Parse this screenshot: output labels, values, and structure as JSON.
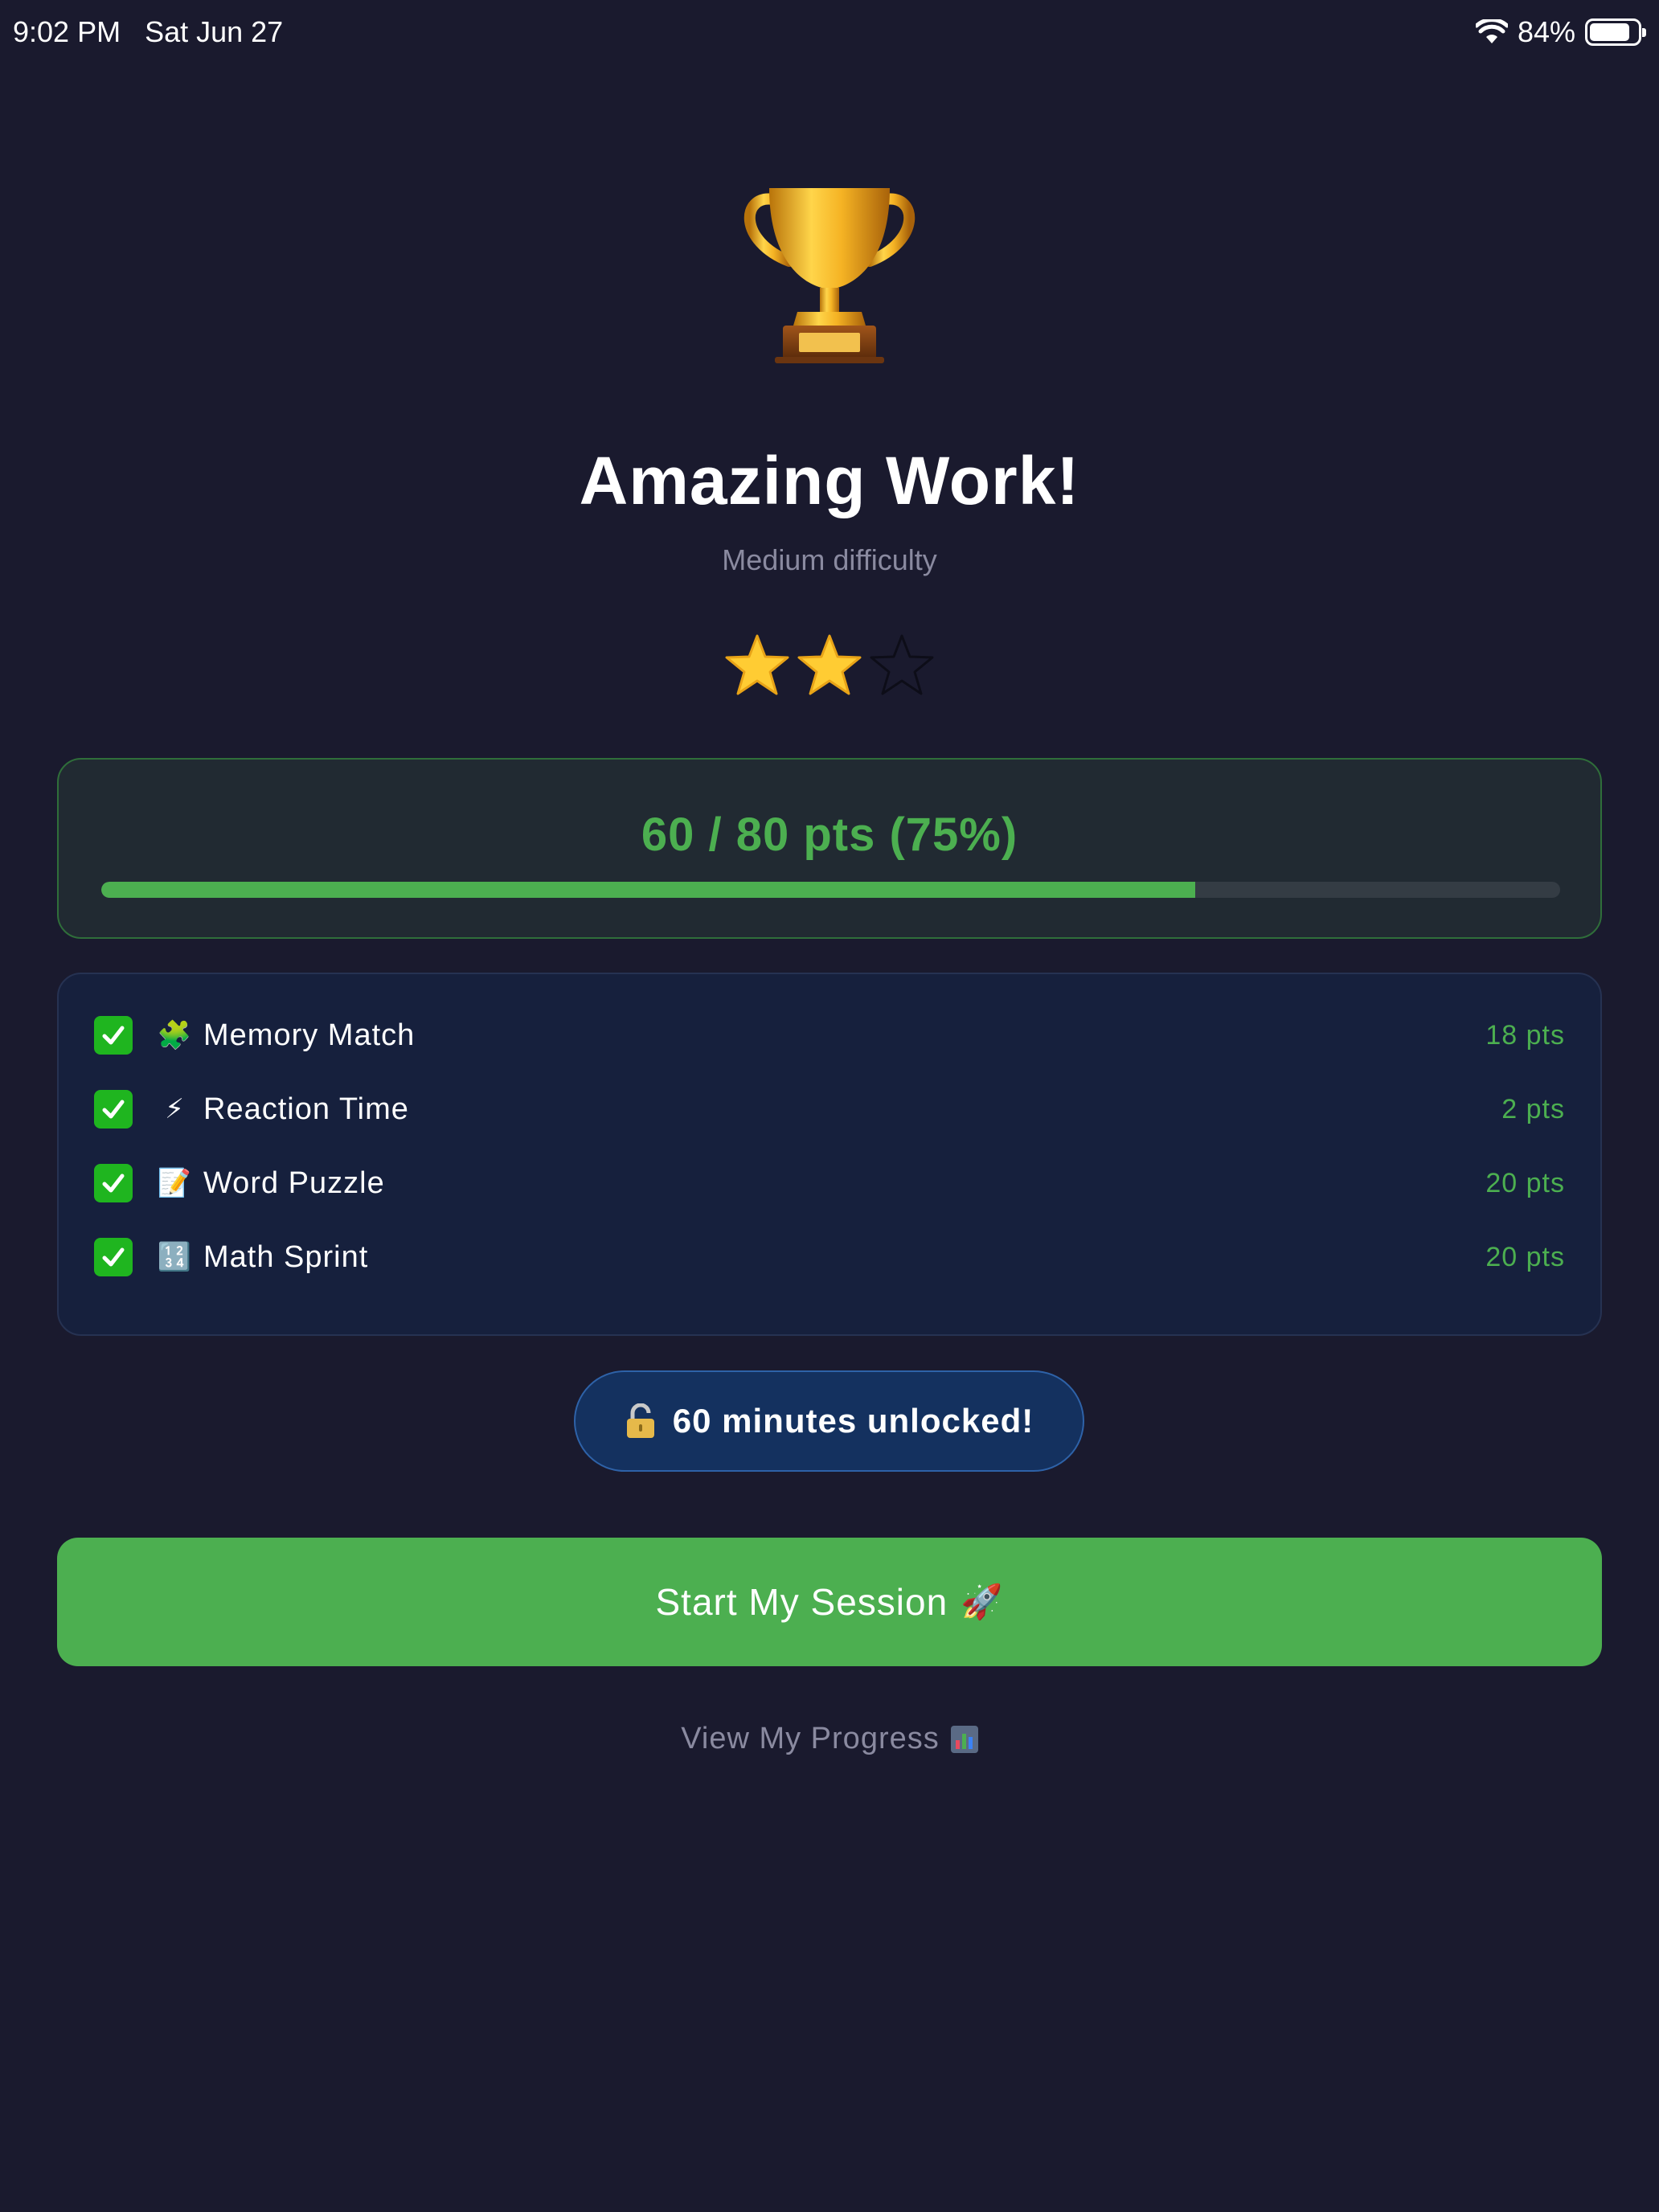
{
  "status_bar": {
    "time": "9:02 PM",
    "date": "Sat Jun 27",
    "battery": "84%",
    "battery_level": 0.84
  },
  "header": {
    "icon": "trophy-icon",
    "title": "Amazing Work!",
    "subtitle": "Medium difficulty"
  },
  "rating": {
    "stars_filled": 2,
    "stars_total": 3
  },
  "score": {
    "text": "60 / 80 pts (75%)",
    "earned": 60,
    "total": 80,
    "percent": 75,
    "color": "#4caf50"
  },
  "games": [
    {
      "icon": "puzzle-piece-icon",
      "glyph": "🧩",
      "name": "Memory Match",
      "points": "18 pts",
      "completed": true
    },
    {
      "icon": "lightning-icon",
      "glyph": "⚡",
      "name": "Reaction Time",
      "points": "2 pts",
      "completed": true
    },
    {
      "icon": "memo-icon",
      "glyph": "📝",
      "name": "Word Puzzle",
      "points": "20 pts",
      "completed": true
    },
    {
      "icon": "numbers-icon",
      "glyph": "🔢",
      "name": "Math Sprint",
      "points": "20 pts",
      "completed": true
    }
  ],
  "unlock": {
    "icon": "unlock-icon",
    "text": "60 minutes unlocked!"
  },
  "actions": {
    "start_label": "Start My Session",
    "start_icon": "rocket-icon",
    "start_glyph": "🚀",
    "progress_label": "View My Progress",
    "progress_icon": "bar-chart-icon"
  },
  "colors": {
    "background": "#1a1a2e",
    "accent_green": "#4caf50",
    "muted_text": "#8a8aa0",
    "card_blue": "#16203d",
    "pill_blue": "#14315f"
  }
}
